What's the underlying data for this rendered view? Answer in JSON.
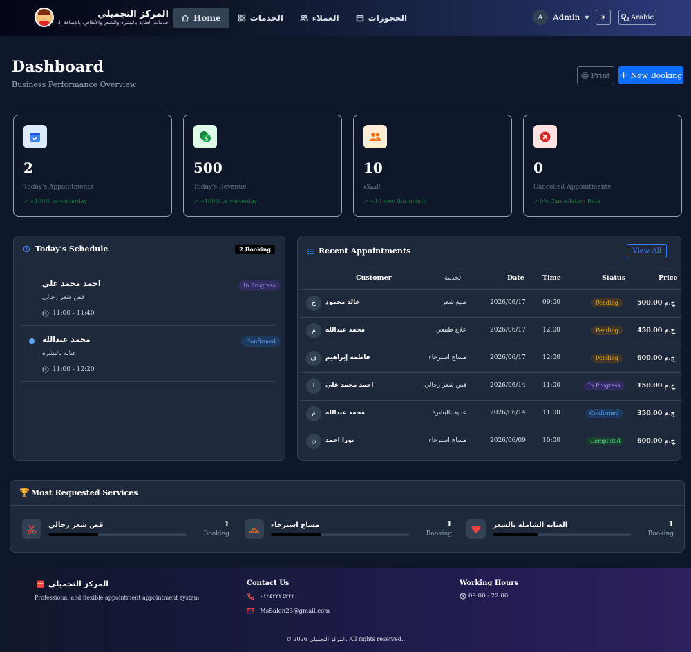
{
  "brand": {
    "name": "المركز التجميلي",
    "tagline": "خدمات العناية بالبشرة والشعر والأظافر، بالإضافة إلى..."
  },
  "nav": [
    {
      "label": "Home",
      "icon": "home-icon"
    },
    {
      "label": "الخدمات",
      "icon": "grid-icon"
    },
    {
      "label": "العملاء",
      "icon": "users-icon"
    },
    {
      "label": "الحجوزات",
      "icon": "calendar-icon"
    }
  ],
  "user": {
    "initial": "A",
    "name": "Admin"
  },
  "language": "Arabic",
  "header": {
    "title": "Dashboard",
    "subtitle": "Business Performance Overview",
    "print": "Print",
    "new_booking": "New Booking"
  },
  "stats": [
    {
      "value": "2",
      "label": "Today's Appointments",
      "trend": "+100% vs yesterday",
      "icon": "calendar-icon",
      "color": "#3b82f6",
      "bg": "#dbeafe"
    },
    {
      "value": "500",
      "label": "Today's Revenue",
      "trend": "+100% vs yesterday",
      "icon": "money-icon",
      "color": "#15803d",
      "bg": "#dcfce7"
    },
    {
      "value": "10",
      "label": "العملاء",
      "trend": "+10 new this month",
      "icon": "users-icon",
      "color": "#f97316",
      "bg": "#ffedd5"
    },
    {
      "value": "0",
      "label": "Cancelled Appointments",
      "trend": "0% Cancellation Rate",
      "icon": "cancel-icon",
      "color": "#dc2626",
      "bg": "#fee2e2"
    }
  ],
  "schedule": {
    "title": "Today's Schedule",
    "count": "2 Booking",
    "items": [
      {
        "name": "احمد محمد علي",
        "service": "قص شعر رجالي",
        "time": "11:00 - 11:40",
        "status": "In Progress"
      },
      {
        "name": "محمد عبدالله",
        "service": "عناية بالبشرة",
        "time": "11:00 - 12:20",
        "status": "Confirmed"
      }
    ]
  },
  "recent": {
    "title": "Recent Appointments",
    "view_all": "View All",
    "columns": [
      "Customer",
      "الخدمة",
      "Date",
      "Time",
      "Status",
      "Price"
    ],
    "rows": [
      {
        "initial": "خ",
        "customer": "خالد محمود",
        "service": "صبغ شعر",
        "date": "2026/06/17",
        "time": "09:00",
        "status": "Pending",
        "price": "500.00 ج.م"
      },
      {
        "initial": "م",
        "customer": "محمد عبدالله",
        "service": "علاج طبيعي",
        "date": "2026/06/17",
        "time": "12:00",
        "status": "Pending",
        "price": "450.00 ج.م"
      },
      {
        "initial": "ف",
        "customer": "فاطمة إبراهيم",
        "service": "مساج استرخاء",
        "date": "2026/06/17",
        "time": "12:00",
        "status": "Pending",
        "price": "600.00 ج.م"
      },
      {
        "initial": "ا",
        "customer": "احمد محمد علي",
        "service": "قص شعر رجالي",
        "date": "2026/06/14",
        "time": "11:00",
        "status": "In Progress",
        "price": "150.00 ج.م"
      },
      {
        "initial": "م",
        "customer": "محمد عبدالله",
        "service": "عناية بالبشرة",
        "date": "2026/06/14",
        "time": "11:00",
        "status": "Confirmed",
        "price": "350.00 ج.م"
      },
      {
        "initial": "ن",
        "customer": "نورا احمد",
        "service": "مساج استرخاء",
        "date": "2026/06/09",
        "time": "10:00",
        "status": "Completed",
        "price": "600.00 ج.م"
      }
    ]
  },
  "services": {
    "title": "Most Requested Services",
    "items": [
      {
        "name": "قص شعر رجالي",
        "count": "1",
        "unit": "Booking",
        "icon": "scissors-icon",
        "share": 0.36
      },
      {
        "name": "مساج استرخاء",
        "count": "1",
        "unit": "Booking",
        "icon": "spa-icon",
        "share": 0.36
      },
      {
        "name": "العناية الشاملة بالشعر",
        "count": "1",
        "unit": "Booking",
        "icon": "heart-icon",
        "share": 0.33
      }
    ]
  },
  "footer": {
    "brand": "المركز التجميلي",
    "description": "Professional and flexible appointment appointment system",
    "contact_title": "Contact Us",
    "phone": "٠١٢٤٣٣٢٤٣٢٣",
    "email": "MsSalon23@gmail.com",
    "hours_title": "Working Hours",
    "hours": "09:00 - 22:00",
    "copyright": "© 2026 المركز التجميلي. All rights reserved.."
  }
}
